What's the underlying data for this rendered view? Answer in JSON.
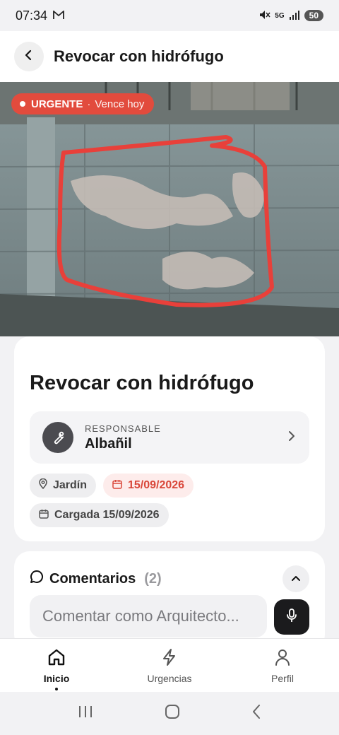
{
  "status_bar": {
    "time": "07:34",
    "network": "5G",
    "battery": "50"
  },
  "header": {
    "title": "Revocar con hidrófugo"
  },
  "photo": {
    "badge_label": "URGENTE",
    "badge_separator": "·",
    "badge_due": "Vence hoy",
    "badge_color": "#e24b3d",
    "annotation_color": "#e8403a"
  },
  "task": {
    "title": "Revocar con hidrófugo",
    "responsible": {
      "caption": "RESPONSABLE",
      "value": "Albañil"
    },
    "location": "Jardín",
    "due_date": "15/09/2026",
    "created": "Cargada 15/09/2026"
  },
  "comments": {
    "title": "Comentarios",
    "count": "(2)",
    "placeholder": "Comentar como Arquitecto..."
  },
  "bottom_nav": [
    {
      "label": "Inicio",
      "icon": "home-icon",
      "active": true
    },
    {
      "label": "Urgencias",
      "icon": "lightning-icon",
      "active": false
    },
    {
      "label": "Perfil",
      "icon": "person-icon",
      "active": false
    }
  ],
  "colors": {
    "accent": "#e24b3d",
    "dark": "#1b1b1d"
  }
}
